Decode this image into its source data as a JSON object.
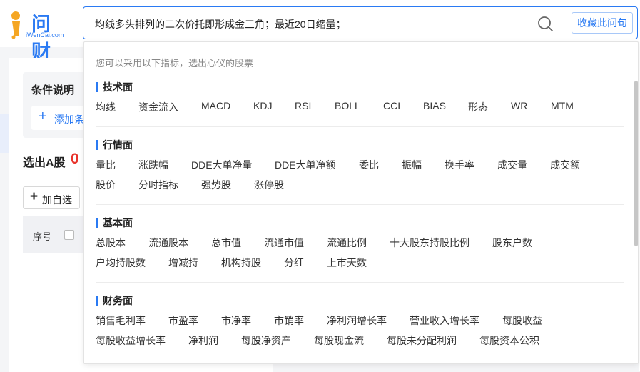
{
  "logo": {
    "text": "问财",
    "sub": "iWenCai.com"
  },
  "search": {
    "query": "均线多头排列的二次价托即形成金三角；最近20日缩量；",
    "collect_label": "收藏此问句"
  },
  "condition": {
    "title": "条件说明",
    "add_label": "添加条"
  },
  "results": {
    "title": "选出A股",
    "count": "0",
    "add_self_label": "加自选"
  },
  "table": {
    "seq_header": "序号"
  },
  "dropdown": {
    "hint": "您可以采用以下指标，选出心仪的股票",
    "sections": [
      {
        "title": "技术面",
        "rows": [
          [
            "均线",
            "资金流入",
            "MACD",
            "KDJ",
            "RSI",
            "BOLL",
            "CCI",
            "BIAS",
            "形态",
            "WR",
            "MTM"
          ]
        ]
      },
      {
        "title": "行情面",
        "rows": [
          [
            "量比",
            "涨跌幅",
            "DDE大单净量",
            "DDE大单净额",
            "委比",
            "振幅",
            "换手率",
            "成交量",
            "成交额"
          ],
          [
            "股价",
            "分时指标",
            "强势股",
            "涨停股"
          ]
        ]
      },
      {
        "title": "基本面",
        "rows": [
          [
            "总股本",
            "流通股本",
            "总市值",
            "流通市值",
            "流通比例",
            "十大股东持股比例",
            "股东户数"
          ],
          [
            "户均持股数",
            "增减持",
            "机构持股",
            "分红",
            "上市天数"
          ]
        ]
      },
      {
        "title": "财务面",
        "rows": [
          [
            "销售毛利率",
            "市盈率",
            "市净率",
            "市销率",
            "净利润增长率",
            "营业收入增长率",
            "每股收益"
          ],
          [
            "每股收益增长率",
            "净利润",
            "每股净资产",
            "每股现金流",
            "每股未分配利润",
            "每股资本公积"
          ]
        ]
      }
    ]
  },
  "colors": {
    "accent": "#2a7af3",
    "count": "#e8332b"
  }
}
